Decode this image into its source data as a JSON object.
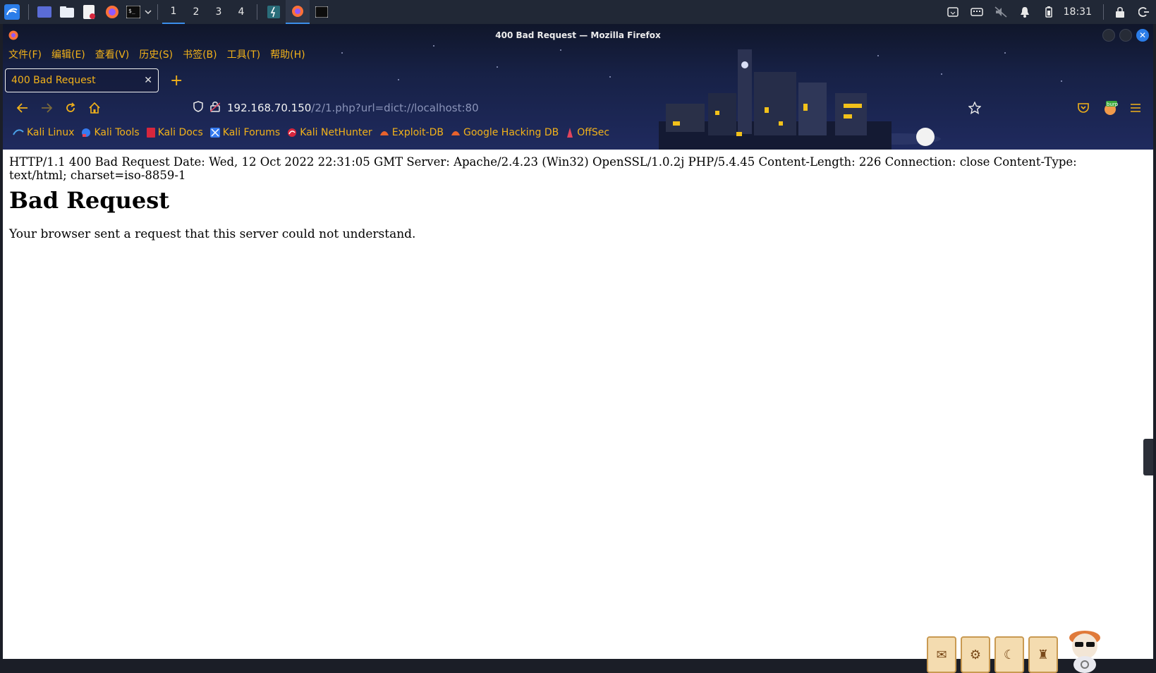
{
  "panel": {
    "workspaces": [
      "1",
      "2",
      "3",
      "4"
    ],
    "active_workspace": "1",
    "clock": "18:31"
  },
  "window": {
    "title": "400 Bad Request — Mozilla Firefox"
  },
  "menubar": {
    "items": [
      "文件(F)",
      "编辑(E)",
      "查看(V)",
      "历史(S)",
      "书签(B)",
      "工具(T)",
      "帮助(H)"
    ]
  },
  "tab": {
    "title": "400 Bad Request"
  },
  "urlbar": {
    "host": "192.168.70.150",
    "path": "/2/1.php?url=dict://localhost:80"
  },
  "bookmarks": [
    "Kali Linux",
    "Kali Tools",
    "Kali Docs",
    "Kali Forums",
    "Kali NetHunter",
    "Exploit-DB",
    "Google Hacking DB",
    "OffSec"
  ],
  "extension_badge": "burp",
  "page": {
    "headers": "HTTP/1.1 400 Bad Request Date: Wed, 12 Oct 2022 22:31:05 GMT Server: Apache/2.4.23 (Win32) OpenSSL/1.0.2j PHP/5.4.45 Content-Length: 226 Connection: close Content-Type: text/html; charset=iso-8859-1",
    "heading": "Bad Request",
    "message": "Your browser sent a request that this server could not understand."
  },
  "colors": {
    "accent": "#f2b21a",
    "panel_bg": "#212836",
    "chrome_bg": "#1f2a5e"
  }
}
